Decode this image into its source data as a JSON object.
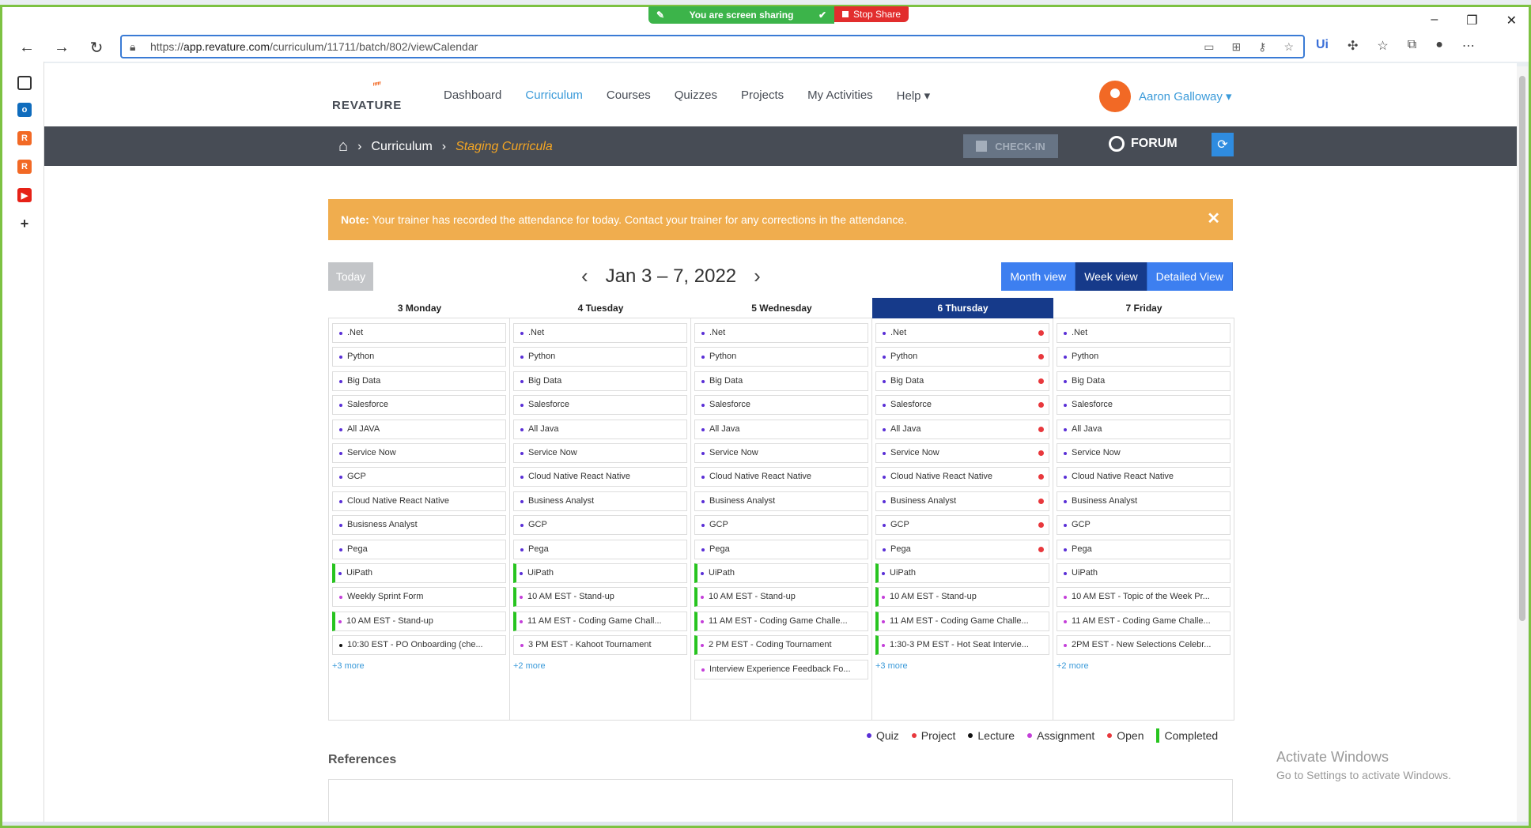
{
  "share": {
    "status": "You are screen sharing",
    "stop": "Stop Share"
  },
  "browser": {
    "url_prefix": "https://",
    "url_host": "app.revature.com",
    "url_path": "/curriculum/11711/batch/802/viewCalendar",
    "controls": {
      "minimize": "–",
      "restore": "❐",
      "close": "✕"
    }
  },
  "nav": {
    "logo": "REVATURE",
    "menu": [
      "Dashboard",
      "Curriculum",
      "Courses",
      "Quizzes",
      "Projects",
      "My Activities",
      "Help ▾"
    ],
    "active_index": 1,
    "user": "Aaron Galloway ▾"
  },
  "breadcrumb": {
    "section": "Curriculum",
    "current": "Staging Curricula"
  },
  "actions": {
    "checkin": "CHECK-IN",
    "forum": "FORUM"
  },
  "note": {
    "label": "Note:",
    "text": "Your trainer has recorded the attendance for today. Contact your trainer for any corrections in the attendance."
  },
  "calendar": {
    "today": "Today",
    "range": "Jan 3 – 7, 2022",
    "views": [
      "Month view",
      "Week view",
      "Detailed View"
    ],
    "active_view": 1,
    "days": [
      {
        "label": "3 Monday",
        "more": "+3 more",
        "events": [
          {
            "t": ".Net",
            "c": "#5a2fd6"
          },
          {
            "t": "Python",
            "c": "#5a2fd6"
          },
          {
            "t": "Big Data",
            "c": "#5a2fd6"
          },
          {
            "t": "Salesforce",
            "c": "#5a2fd6"
          },
          {
            "t": "All JAVA",
            "c": "#5a2fd6"
          },
          {
            "t": "Service Now",
            "c": "#5a2fd6"
          },
          {
            "t": "GCP",
            "c": "#5a2fd6"
          },
          {
            "t": "Cloud Native React Native",
            "c": "#5a2fd6"
          },
          {
            "t": "Busisness Analyst",
            "c": "#5a2fd6"
          },
          {
            "t": "Pega",
            "c": "#5a2fd6"
          },
          {
            "t": "UiPath",
            "c": "#5a2fd6",
            "done": true
          },
          {
            "t": "Weekly Sprint Form",
            "c": "#c43fd9"
          },
          {
            "t": "10 AM EST - Stand-up",
            "c": "#c43fd9",
            "done": true
          },
          {
            "t": "10:30 EST - PO Onboarding (che...",
            "c": "#111"
          }
        ]
      },
      {
        "label": "4 Tuesday",
        "more": "+2 more",
        "events": [
          {
            "t": ".Net",
            "c": "#5a2fd6"
          },
          {
            "t": "Python",
            "c": "#5a2fd6"
          },
          {
            "t": "Big Data",
            "c": "#5a2fd6"
          },
          {
            "t": "Salesforce",
            "c": "#5a2fd6"
          },
          {
            "t": "All Java",
            "c": "#5a2fd6"
          },
          {
            "t": "Service Now",
            "c": "#5a2fd6"
          },
          {
            "t": "Cloud Native React Native",
            "c": "#5a2fd6"
          },
          {
            "t": "Business Analyst",
            "c": "#5a2fd6"
          },
          {
            "t": "GCP",
            "c": "#5a2fd6"
          },
          {
            "t": "Pega",
            "c": "#5a2fd6"
          },
          {
            "t": "UiPath",
            "c": "#5a2fd6",
            "done": true
          },
          {
            "t": "10 AM EST - Stand-up",
            "c": "#c43fd9",
            "done": true
          },
          {
            "t": "11 AM EST - Coding Game Chall...",
            "c": "#c43fd9",
            "done": true
          },
          {
            "t": "3 PM EST - Kahoot Tournament",
            "c": "#c43fd9"
          }
        ]
      },
      {
        "label": "5 Wednesday",
        "more": "",
        "events": [
          {
            "t": ".Net",
            "c": "#5a2fd6"
          },
          {
            "t": "Python",
            "c": "#5a2fd6"
          },
          {
            "t": "Big Data",
            "c": "#5a2fd6"
          },
          {
            "t": "Salesforce",
            "c": "#5a2fd6"
          },
          {
            "t": "All Java",
            "c": "#5a2fd6"
          },
          {
            "t": "Service Now",
            "c": "#5a2fd6"
          },
          {
            "t": "Cloud Native React Native",
            "c": "#5a2fd6"
          },
          {
            "t": "Business Analyst",
            "c": "#5a2fd6"
          },
          {
            "t": "GCP",
            "c": "#5a2fd6"
          },
          {
            "t": "Pega",
            "c": "#5a2fd6"
          },
          {
            "t": "UiPath",
            "c": "#5a2fd6",
            "done": true
          },
          {
            "t": "10 AM EST - Stand-up",
            "c": "#c43fd9",
            "done": true
          },
          {
            "t": "11 AM EST - Coding Game Challe...",
            "c": "#c43fd9",
            "done": true
          },
          {
            "t": "2 PM EST - Coding Tournament",
            "c": "#c43fd9",
            "done": true
          },
          {
            "t": "Interview Experience Feedback Fo...",
            "c": "#c43fd9"
          }
        ]
      },
      {
        "label": "6 Thursday",
        "active": true,
        "more": "+3 more",
        "events": [
          {
            "t": ".Net",
            "c": "#5a2fd6",
            "open": true
          },
          {
            "t": "Python",
            "c": "#5a2fd6",
            "open": true
          },
          {
            "t": "Big Data",
            "c": "#5a2fd6",
            "open": true
          },
          {
            "t": "Salesforce",
            "c": "#5a2fd6",
            "open": true
          },
          {
            "t": "All Java",
            "c": "#5a2fd6",
            "open": true
          },
          {
            "t": "Service Now",
            "c": "#5a2fd6",
            "open": true
          },
          {
            "t": "Cloud Native React Native",
            "c": "#5a2fd6",
            "open": true
          },
          {
            "t": "Business Analyst",
            "c": "#5a2fd6",
            "open": true
          },
          {
            "t": "GCP",
            "c": "#5a2fd6",
            "open": true
          },
          {
            "t": "Pega",
            "c": "#5a2fd6",
            "open": true
          },
          {
            "t": "UiPath",
            "c": "#5a2fd6",
            "done": true
          },
          {
            "t": "10 AM EST - Stand-up",
            "c": "#c43fd9",
            "done": true
          },
          {
            "t": "11 AM EST - Coding Game Challe...",
            "c": "#c43fd9",
            "done": true
          },
          {
            "t": "1:30-3 PM EST - Hot Seat Intervie...",
            "c": "#c43fd9",
            "done": true
          }
        ]
      },
      {
        "label": "7 Friday",
        "more": "+2 more",
        "events": [
          {
            "t": ".Net",
            "c": "#5a2fd6"
          },
          {
            "t": "Python",
            "c": "#5a2fd6"
          },
          {
            "t": "Big Data",
            "c": "#5a2fd6"
          },
          {
            "t": "Salesforce",
            "c": "#5a2fd6"
          },
          {
            "t": "All Java",
            "c": "#5a2fd6"
          },
          {
            "t": "Service Now",
            "c": "#5a2fd6"
          },
          {
            "t": "Cloud Native React Native",
            "c": "#5a2fd6"
          },
          {
            "t": "Business Analyst",
            "c": "#5a2fd6"
          },
          {
            "t": "GCP",
            "c": "#5a2fd6"
          },
          {
            "t": "Pega",
            "c": "#5a2fd6"
          },
          {
            "t": "UiPath",
            "c": "#5a2fd6"
          },
          {
            "t": "10 AM EST - Topic of the Week Pr...",
            "c": "#c43fd9"
          },
          {
            "t": "11 AM EST - Coding Game Challe...",
            "c": "#c43fd9"
          },
          {
            "t": "2PM EST - New Selections Celebr...",
            "c": "#c43fd9"
          }
        ]
      }
    ]
  },
  "legend": [
    {
      "label": "Quiz",
      "color": "#5a2fd6"
    },
    {
      "label": "Project",
      "color": "#e8383d"
    },
    {
      "label": "Lecture",
      "color": "#111111"
    },
    {
      "label": "Assignment",
      "color": "#c43fd9"
    },
    {
      "label": "Open",
      "color": "#e8383d"
    },
    {
      "label": "Completed",
      "color": "#27c41f"
    }
  ],
  "references": {
    "title": "References"
  },
  "watermark": {
    "line1": "Activate Windows",
    "line2": "Go to Settings to activate Windows."
  }
}
